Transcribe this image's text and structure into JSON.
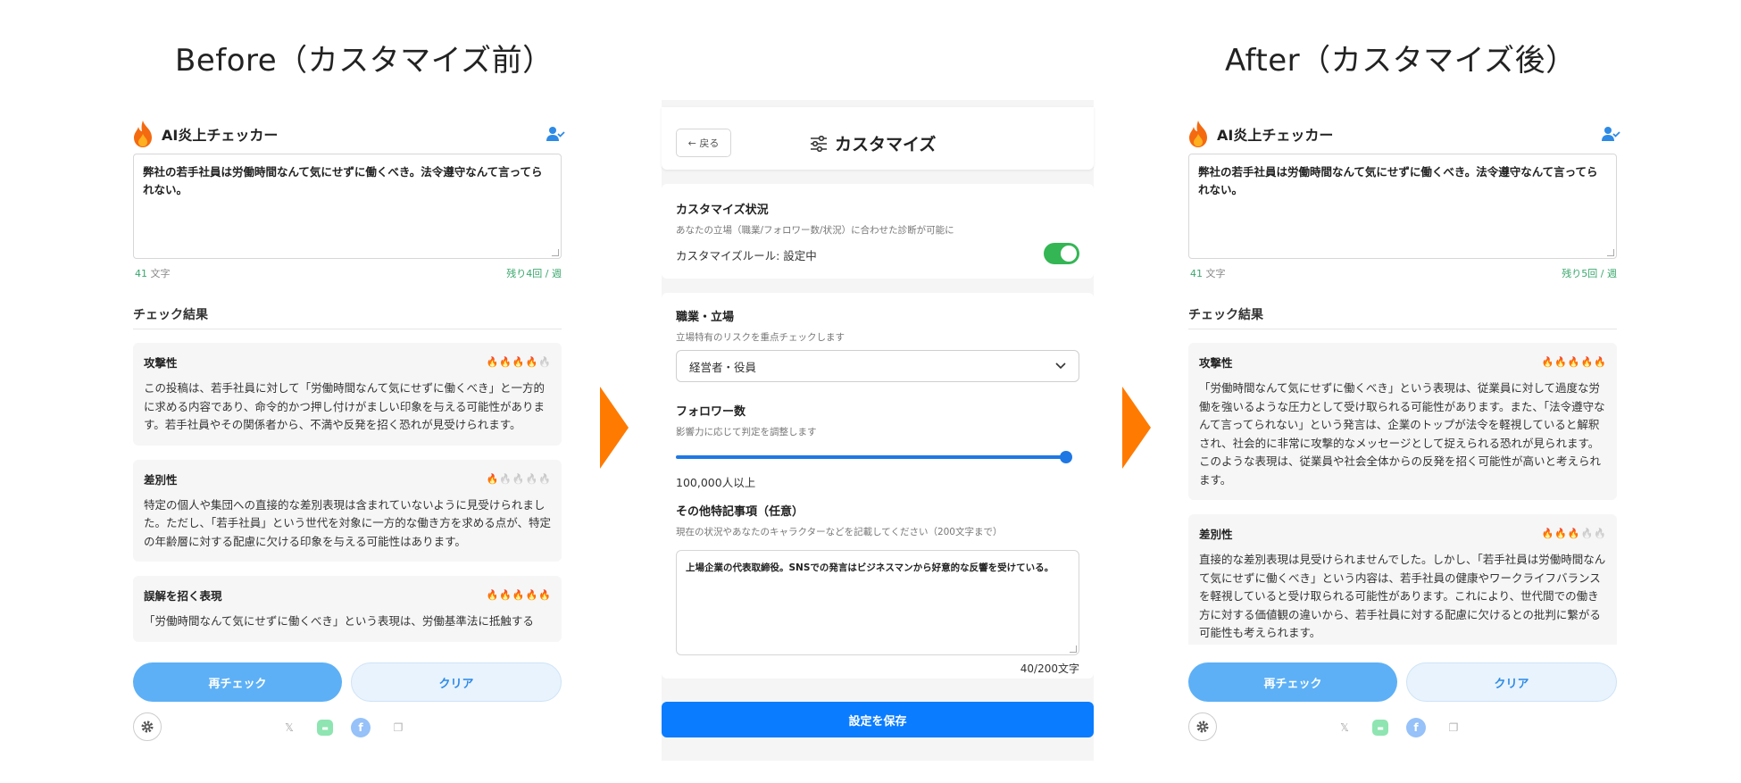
{
  "headings": {
    "before": "Before（カスタマイズ前）",
    "after": "After（カスタマイズ後）"
  },
  "colors": {
    "accent": "#0a7cff",
    "arrow": "#ff7a00",
    "flame": "#f46a10",
    "toggle_on": "#34b655"
  },
  "before_panel": {
    "app_title": "AI炎上チェッカー",
    "input_text": "弊社の若手社員は労働時間なんて気にせずに働くべき。法令遵守なんて言ってられない。",
    "char_count_num": "41",
    "char_count_unit": "文字",
    "remaining": "残り4回 / 週",
    "result_title": "チェック結果",
    "cards": [
      {
        "title": "攻撃性",
        "flames": 4,
        "body": "この投稿は、若手社員に対して「労働時間なんて気にせずに働くべき」と一方的に求める内容であり、命令的かつ押し付けがましい印象を与える可能性があります。若手社員やその関係者から、不満や反発を招く恐れが見受けられます。"
      },
      {
        "title": "差別性",
        "flames": 1,
        "body": "特定の個人や集団への直接的な差別表現は含まれていないように見受けられました。ただし、「若手社員」という世代を対象に一方的な働き方を求める点が、特定の年齢層に対する配慮に欠ける印象を与える可能性はあります。"
      },
      {
        "title": "誤解を招く表現",
        "flames": 5,
        "body": "「労働時間なんて気にせずに働くべき」という表現は、労働基準法に抵触する"
      }
    ],
    "recheck_label": "再チェック",
    "clear_label": "クリア"
  },
  "after_panel": {
    "app_title": "AI炎上チェッカー",
    "input_text": "弊社の若手社員は労働時間なんて気にせずに働くべき。法令遵守なんて言ってられない。",
    "char_count_num": "41",
    "char_count_unit": "文字",
    "remaining": "残り5回 / 週",
    "result_title": "チェック結果",
    "cards": [
      {
        "title": "攻撃性",
        "flames": 5,
        "body": "「労働時間なんて気にせずに働くべき」という表現は、従業員に対して過度な労働を強いるような圧力として受け取られる可能性があります。また、「法令遵守なんて言ってられない」という発言は、企業のトップが法令を軽視していると解釈され、社会的に非常に攻撃的なメッセージとして捉えられる恐れが見られます。このような表現は、従業員や社会全体からの反発を招く可能性が高いと考えられます。"
      },
      {
        "title": "差別性",
        "flames": 3,
        "body": "直接的な差別表現は見受けられませんでした。しかし、「若手社員は労働時間なんて気にせずに働くべき」という内容は、若手社員の健康やワークライフバランスを軽視していると受け取られる可能性があります。これにより、世代間での働き方に対する価値観の違いから、若手社員に対する配慮に欠けるとの批判に繋がる可能性も考えられます。"
      }
    ],
    "recheck_label": "再チェック",
    "clear_label": "クリア"
  },
  "customize": {
    "back_label": "← 戻る",
    "title": "カスタマイズ",
    "status_label": "カスタマイズ状況",
    "status_sub": "あなたの立場（職業/フォロワー数/状況）に合わせた診断が可能に",
    "rule_label": "カスタマイズルール: 設定中",
    "rule_enabled": true,
    "job_label": "職業・立場",
    "job_sub": "立場特有のリスクを重点チェックします",
    "job_value": "経営者・役員",
    "followers_label": "フォロワー数",
    "followers_sub": "影響力に応じて判定を調整します",
    "followers_level": 1.0,
    "followers_value": "100,000人以上",
    "notes_label": "その他特記事項（任意）",
    "notes_sub": "現在の状況やあなたのキャラクターなどを記載してください（200文字まで）",
    "notes_value": "上場企業の代表取締役。SNSでの発言はビジネスマンから好意的な反響を受けている。",
    "notes_count": "40/200文字",
    "save_label": "設定を保存"
  }
}
